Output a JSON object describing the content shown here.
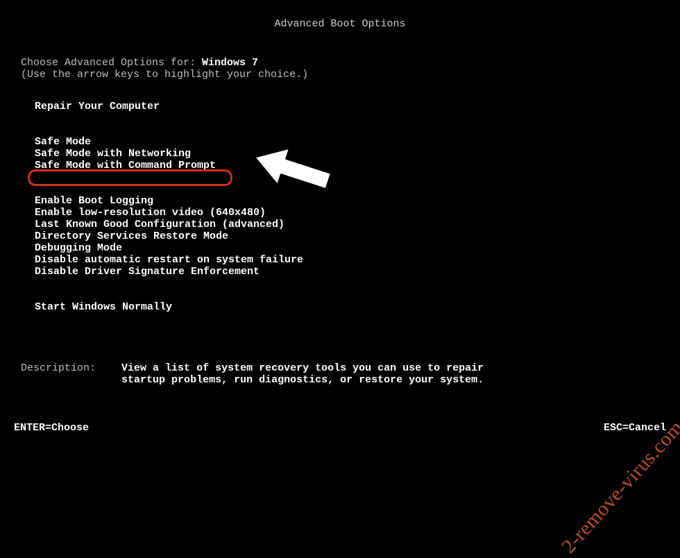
{
  "title": "Advanced Boot Options",
  "intro": {
    "prefix": "Choose Advanced Options for: ",
    "os": "Windows 7",
    "hint": "(Use the arrow keys to highlight your choice.)"
  },
  "menu": {
    "group0": [
      "Repair Your Computer"
    ],
    "group1": [
      "Safe Mode",
      "Safe Mode with Networking",
      "Safe Mode with Command Prompt"
    ],
    "group2": [
      "Enable Boot Logging",
      "Enable low-resolution video (640x480)",
      "Last Known Good Configuration (advanced)",
      "Directory Services Restore Mode",
      "Debugging Mode",
      "Disable automatic restart on system failure",
      "Disable Driver Signature Enforcement"
    ],
    "group3": [
      "Start Windows Normally"
    ]
  },
  "description": {
    "label": "Description:",
    "text": "View a list of system recovery tools you can use to repair\nstartup problems, run diagnostics, or restore your system."
  },
  "footer": {
    "left": "ENTER=Choose",
    "right": "ESC=Cancel"
  },
  "watermark": "2-remove-virus.com"
}
